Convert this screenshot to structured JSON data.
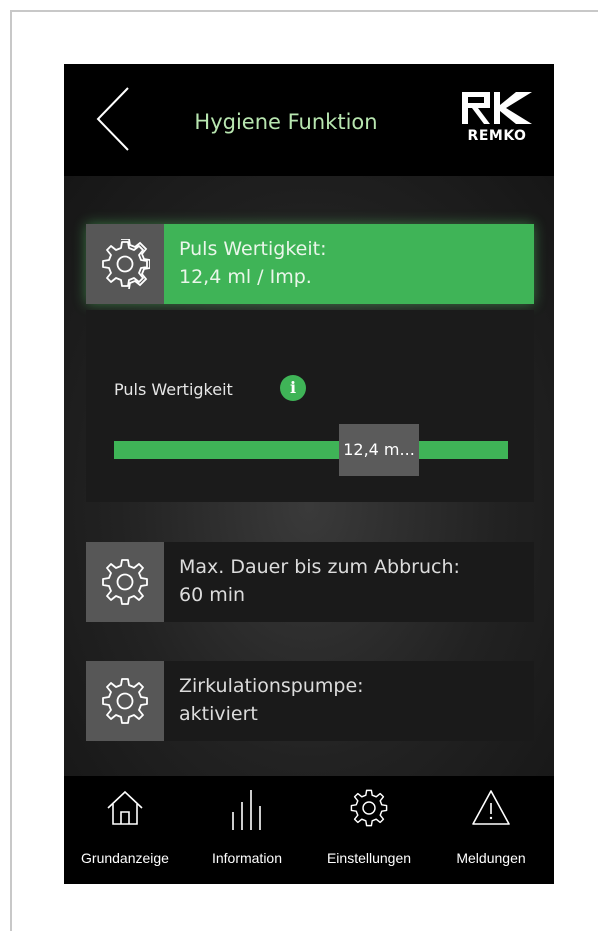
{
  "header": {
    "title": "Hygiene Funktion",
    "logo_text": "REMKO"
  },
  "settings": [
    {
      "label": "Puls Wertigkeit:",
      "value": "12,4 ml / Imp.",
      "active": true
    },
    {
      "label": "Max. Dauer bis zum Abbruch:",
      "value": "60 min",
      "active": false
    },
    {
      "label": "Zirkulationspumpe:",
      "value": "aktiviert",
      "active": false
    }
  ],
  "panel": {
    "label": "Puls Wertigkeit",
    "info_icon": "info-icon",
    "slider_value": "12,4 m...",
    "slider_fraction": 0.62
  },
  "nav": [
    {
      "label": "Grundanzeige",
      "icon": "home-icon"
    },
    {
      "label": "Information",
      "icon": "bars-icon"
    },
    {
      "label": "Einstellungen",
      "icon": "gear-icon"
    },
    {
      "label": "Meldungen",
      "icon": "warning-icon"
    }
  ],
  "colors": {
    "accent": "#3fb457",
    "title": "#b8e6b0",
    "gear_box": "#575757"
  }
}
